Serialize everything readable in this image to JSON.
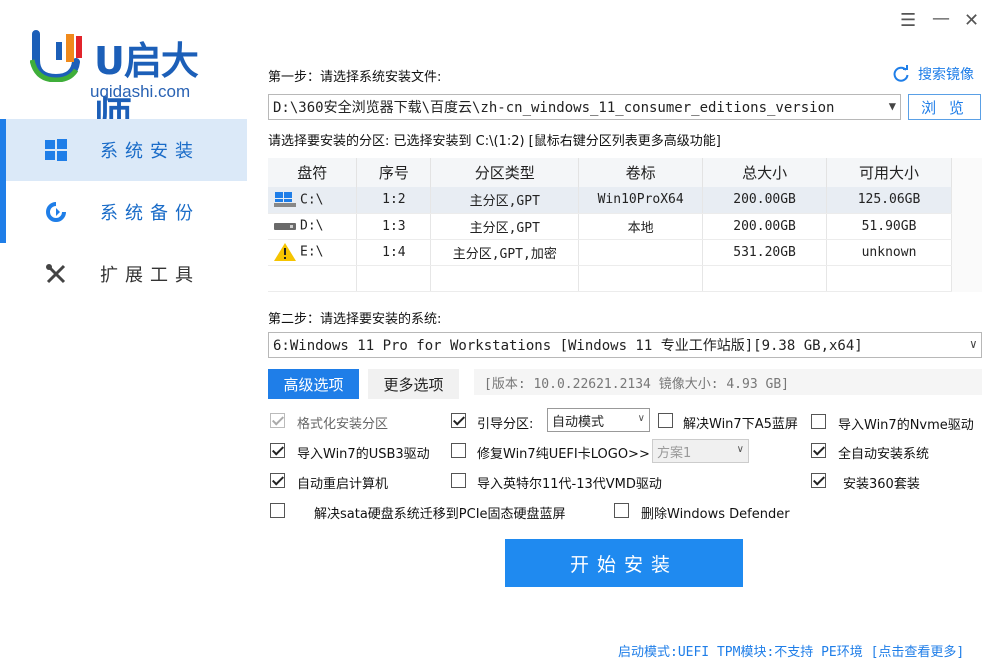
{
  "brand": {
    "logo_text": "U启大师",
    "url": "uqidashi.com"
  },
  "sidebar": {
    "items": [
      {
        "label": "系统安装",
        "icon": "windows-icon",
        "active": true
      },
      {
        "label": "系统备份",
        "icon": "backup-refresh-icon",
        "active": false
      },
      {
        "label": "扩展工具",
        "icon": "tools-icon",
        "active": false
      }
    ]
  },
  "window": {
    "controls": [
      "menu-icon",
      "minimize-icon",
      "close-icon"
    ]
  },
  "step1": {
    "label": "第一步：请选择系统安装文件:",
    "search_mirror": "搜索镜像",
    "file_path": "D:\\360安全浏览器下载\\百度云\\zh-cn_windows_11_consumer_editions_version",
    "browse_label": "浏 览",
    "partition_hint": "请选择要安装的分区: 已选择安装到 C:\\(1:2) [鼠标右键分区列表更多高级功能]"
  },
  "partition_table": {
    "columns": [
      "盘符",
      "序号",
      "分区类型",
      "卷标",
      "总大小",
      "可用大小"
    ],
    "rows": [
      {
        "drive": "C:\\",
        "icon": "windows-drive-icon",
        "index": "1:2",
        "type": "主分区,GPT",
        "label": "Win10ProX64",
        "total": "200.00GB",
        "free": "125.06GB",
        "selected": true
      },
      {
        "drive": "D:\\",
        "icon": "disk-drive-icon",
        "index": "1:3",
        "type": "主分区,GPT",
        "label": "本地",
        "total": "200.00GB",
        "free": "51.90GB",
        "selected": false
      },
      {
        "drive": "E:\\",
        "icon": "warning-drive-icon",
        "index": "1:4",
        "type": "主分区,GPT,加密",
        "label": "",
        "total": "531.20GB",
        "free": "unknown",
        "selected": false
      }
    ]
  },
  "step2": {
    "label": "第二步：请选择要安装的系统:",
    "system": "6:Windows 11 Pro for Workstations [Windows 11 专业工作站版][9.38 GB,x64]"
  },
  "tabs": {
    "advanced": "高级选项",
    "more": "更多选项",
    "version_info": "[版本: 10.0.22621.2134 镜像大小: 4.93 GB]"
  },
  "options": {
    "format_partition": {
      "label": "格式化安装分区",
      "checked": true
    },
    "boot_partition": {
      "label": "引导分区:",
      "checked": true
    },
    "boot_mode": "自动模式",
    "fix_win7_a5": {
      "label": "解决Win7下A5蓝屏",
      "checked": false
    },
    "import_win7_nvme": {
      "label": "导入Win7的Nvme驱动",
      "checked": false
    },
    "import_win7_usb3": {
      "label": "导入Win7的USB3驱动",
      "checked": true
    },
    "fix_win7_uefi": {
      "label": "修复Win7纯UEFI卡LOGO>>",
      "checked": false
    },
    "scheme": "方案1",
    "full_auto": {
      "label": "全自动安装系统",
      "checked": true
    },
    "auto_reboot": {
      "label": "自动重启计算机",
      "checked": true
    },
    "intel_driver": {
      "label": "导入英特尔11代-13代VMD驱动",
      "checked": false
    },
    "install_360": {
      "label": "安装360套装",
      "checked": true
    },
    "fix_sata": {
      "label": "解决sata硬盘系统迁移到PCIe固态硬盘蓝屏",
      "checked": false
    },
    "remove_defender": {
      "label": "删除Windows Defender",
      "checked": false
    }
  },
  "start_button": "开始安装",
  "status_bar": "启动模式:UEFI TPM模块:不支持 PE环境 [点击查看更多]",
  "colors": {
    "accent": "#1f7ee8",
    "sidebar_active": "#dbe9f8"
  }
}
